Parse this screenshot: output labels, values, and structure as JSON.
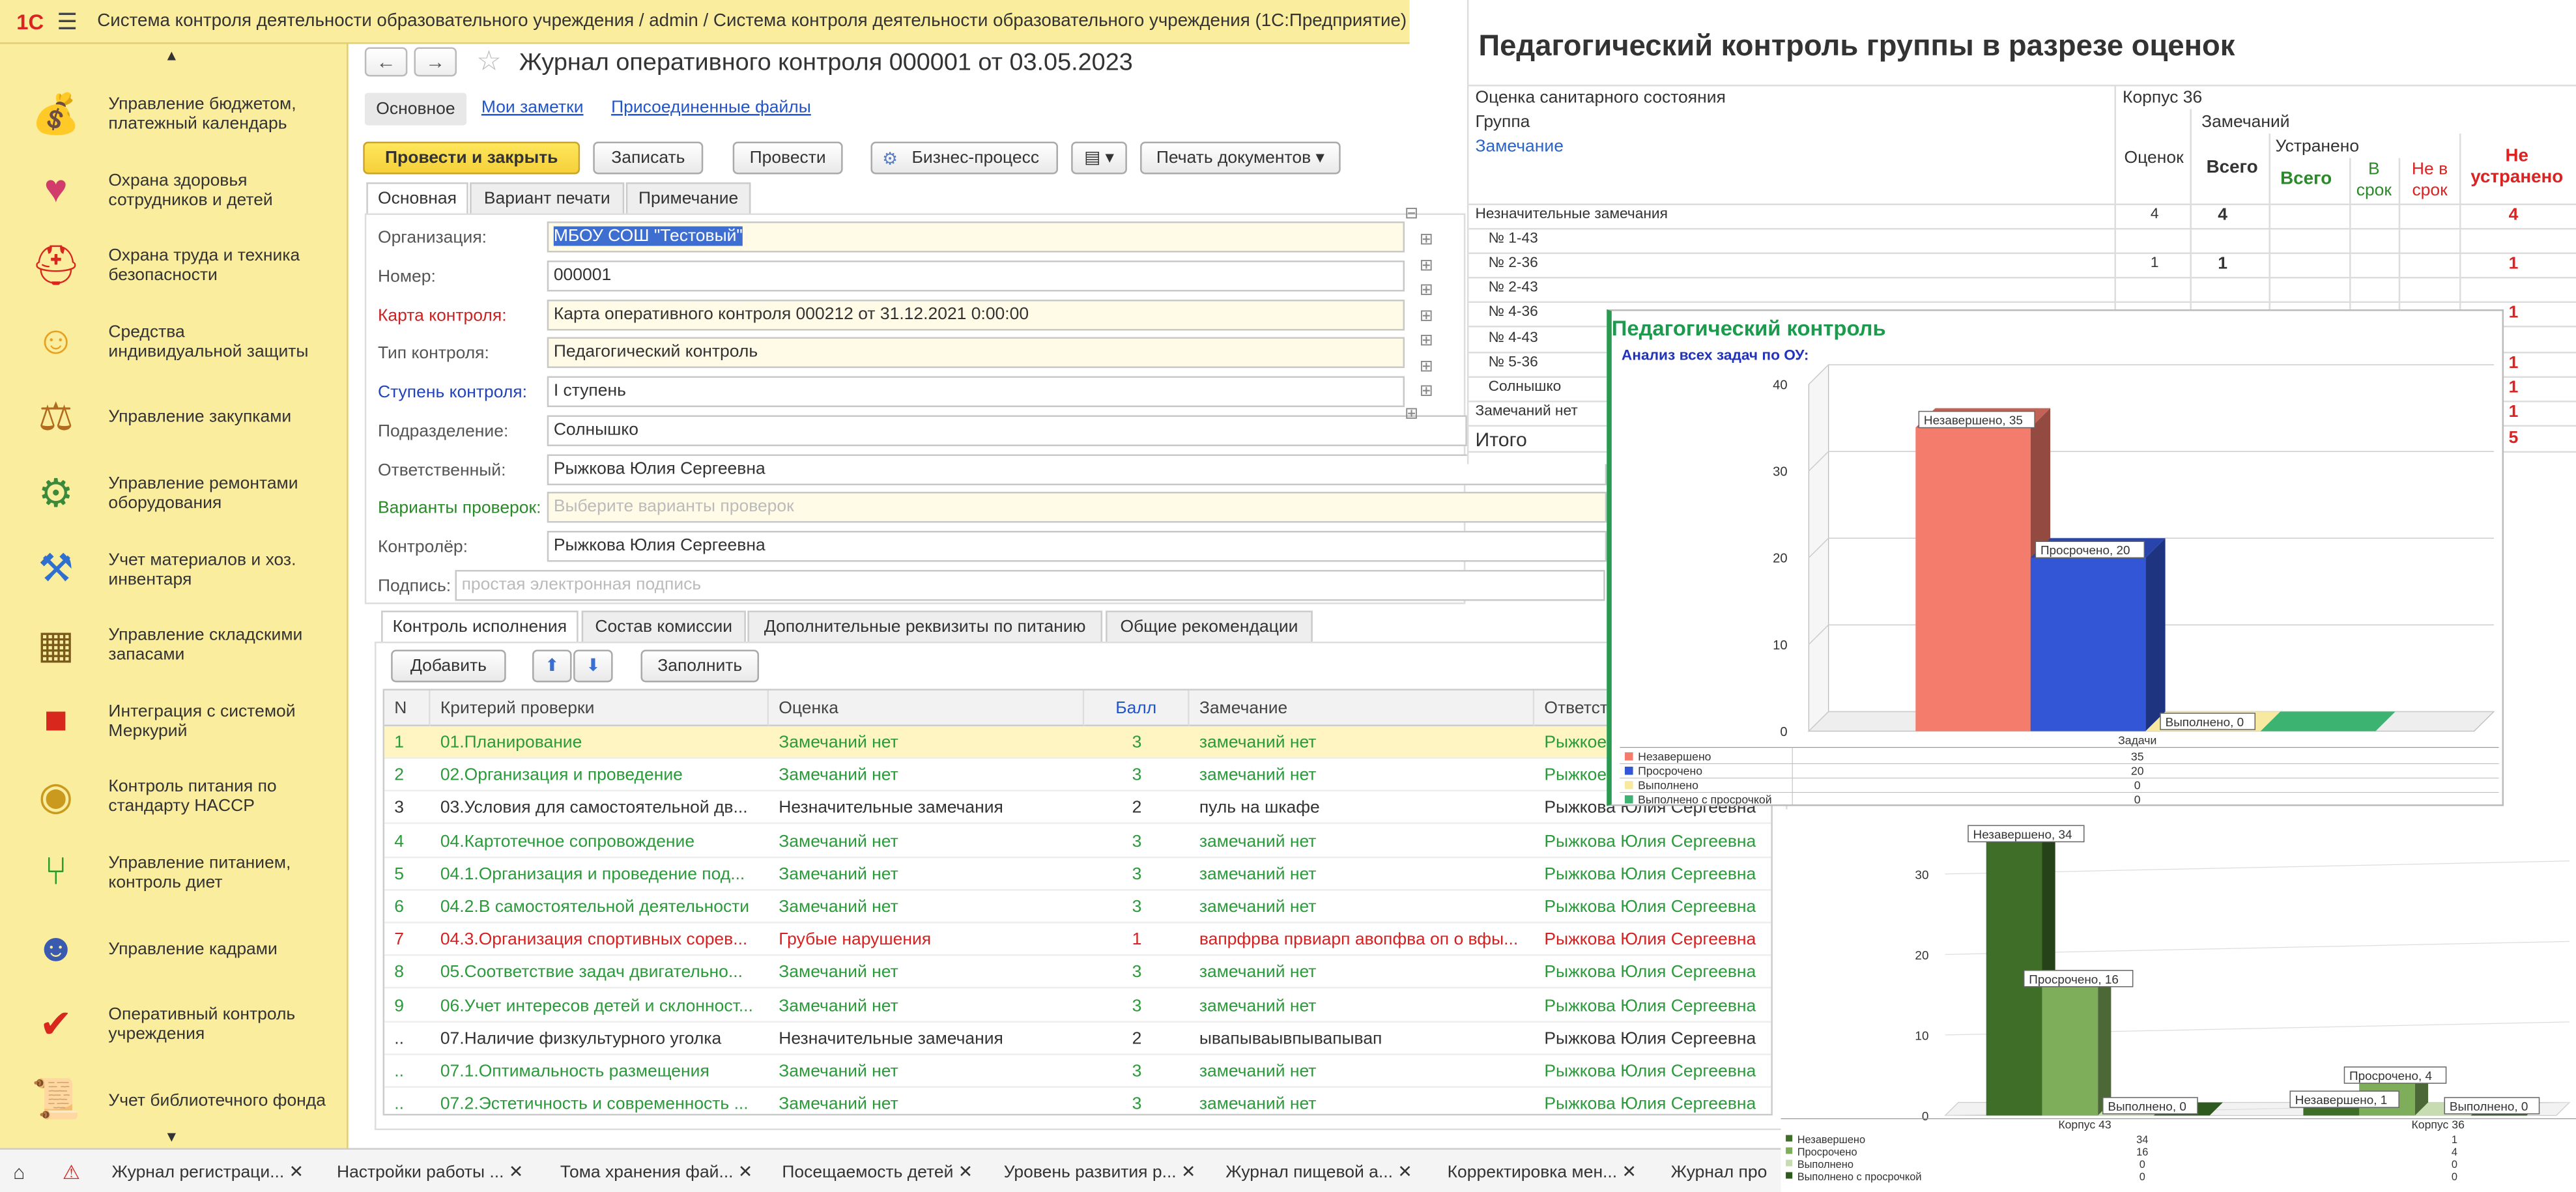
{
  "window": {
    "logo": "1С",
    "title": "Система контроля деятельности образовательного учреждения / admin / Система контроля деятельности образовательного учреждения  (1С:Предприятие)"
  },
  "sidebar": {
    "items": [
      {
        "label": "Управление бюджетом,\nплатежный календарь",
        "icon": "budget-icon"
      },
      {
        "label": "Охрана здоровья\nсотрудников и детей",
        "icon": "health-icon"
      },
      {
        "label": "Охрана труда и техника\nбезопасности",
        "icon": "helmet-icon"
      },
      {
        "label": "Средства\nиндивидуальной защиты",
        "icon": "ppe-icon"
      },
      {
        "label": "Управление закупками",
        "icon": "scales-icon"
      },
      {
        "label": "Управление ремонтами\nоборудования",
        "icon": "gears-icon"
      },
      {
        "label": "Учет материалов и хоз.\nинвентаря",
        "icon": "inventory-icon"
      },
      {
        "label": "Управление складскими\nзапасами",
        "icon": "forklift-icon"
      },
      {
        "label": "Интеграция с системой\nМеркурий",
        "icon": "cube-icon"
      },
      {
        "label": "Контроль питания по\nстандарту HACCP",
        "icon": "haccp-icon"
      },
      {
        "label": "Управление питанием,\nконтроль диет",
        "icon": "cutlery-icon"
      },
      {
        "label": "Управление кадрами",
        "icon": "person-icon"
      },
      {
        "label": "Оперативный контроль\nучреждения",
        "icon": "checkmark-icon"
      },
      {
        "label": "Учет библиотечного фонда",
        "icon": "scroll-icon"
      }
    ]
  },
  "document": {
    "title": "Журнал оперативного контроля 000001 от 03.05.2023",
    "top_tabs": [
      "Основное",
      "Мои заметки",
      "Присоединенные файлы"
    ],
    "toolbar": {
      "post_close": "Провести и закрыть",
      "save": "Записать",
      "post": "Провести",
      "bp": "Бизнес-процесс",
      "print": "Печать документов"
    },
    "form_tabs": [
      "Основная",
      "Вариант печати",
      "Примечание"
    ],
    "fields": {
      "org_label": "Организация:",
      "org_value": "МБОУ СОШ \"Тестовый\"",
      "num_label": "Номер:",
      "num_value": "000001",
      "card_label": "Карта контроля:",
      "card_value": "Карта оперативного контроля 000212 от 31.12.2021 0:00:00",
      "type_label": "Тип контроля:",
      "type_value": "Педагогический контроль",
      "step_label": "Ступень контроля:",
      "step_value": "I ступень",
      "dept_label": "Подразделение:",
      "dept_value": "Солнышко",
      "resp_label": "Ответственный:",
      "resp_value": "Рыжкова Юлия Сергеевна",
      "variants_label": "Варианты проверок:",
      "variants_placeholder": "Выберите варианты проверок",
      "ctrl_label": "Контролёр:",
      "ctrl_value": "Рыжкова Юлия Сергеевна",
      "sign_label": "Подпись:",
      "sign_placeholder": "простая электронная подпись"
    },
    "lower_tabs": [
      "Контроль исполнения",
      "Состав комиссии",
      "Дополнительные реквизиты по питанию",
      "Общие рекомендации"
    ],
    "lower_toolbar": {
      "add": "Добавить",
      "fill": "Заполнить"
    },
    "grid": {
      "headers": [
        "N",
        "Критерий проверки",
        "Оценка",
        "Балл",
        "Замечание",
        "Ответст"
      ],
      "rows": [
        {
          "n": "1",
          "criterion": "01.Планирование",
          "grade": "Замечаний нет",
          "score": "3",
          "remark": "замечаний нет",
          "resp": "Рыжкое",
          "style": "green",
          "selected": true
        },
        {
          "n": "2",
          "criterion": "02.Организация и проведение",
          "grade": "Замечаний нет",
          "score": "3",
          "remark": "замечаний нет",
          "resp": "Рыжкое",
          "style": "green"
        },
        {
          "n": "3",
          "criterion": "03.Условия для самостоятельной дв...",
          "grade": "Незначительные замечания",
          "score": "2",
          "remark": "пуль на шкафе",
          "resp": "Рыжкова Юлия Сергеевна",
          "style": "black"
        },
        {
          "n": "4",
          "criterion": "04.Картотечное сопровождение",
          "grade": "Замечаний нет",
          "score": "3",
          "remark": "замечаний нет",
          "resp": "Рыжкова Юлия Сергеевна",
          "style": "green"
        },
        {
          "n": "5",
          "criterion": "04.1.Организация и проведение под...",
          "grade": "Замечаний нет",
          "score": "3",
          "remark": "замечаний нет",
          "resp": "Рыжкова Юлия Сергеевна",
          "style": "green"
        },
        {
          "n": "6",
          "criterion": "04.2.В самостоятельной деятельности",
          "grade": "Замечаний нет",
          "score": "3",
          "remark": "замечаний нет",
          "resp": "Рыжкова Юлия Сергеевна",
          "style": "green"
        },
        {
          "n": "7",
          "criterion": "04.3.Организация спортивных сорев...",
          "grade": "Грубые нарушения",
          "score": "1",
          "remark": "вапрфрва првиарп авопфва оп о вфы...",
          "resp": "Рыжкова Юлия Сергеевна",
          "style": "red"
        },
        {
          "n": "8",
          "criterion": "05.Соответствие задач двигательно...",
          "grade": "Замечаний нет",
          "score": "3",
          "remark": "замечаний нет",
          "resp": "Рыжкова Юлия Сергеевна",
          "style": "green"
        },
        {
          "n": "9",
          "criterion": "06.Учет интересов детей и склонност...",
          "grade": "Замечаний нет",
          "score": "3",
          "remark": "замечаний нет",
          "resp": "Рыжкова Юлия Сергеевна",
          "style": "green"
        },
        {
          "n": "..",
          "criterion": "07.Наличие физкультурного  уголка",
          "grade": "Незначительные замечания",
          "score": "2",
          "remark": "ывапываывпывапывап",
          "resp": "Рыжкова Юлия Сергеевна",
          "style": "black"
        },
        {
          "n": "..",
          "criterion": "07.1.Оптимальность размещения",
          "grade": "Замечаний нет",
          "score": "3",
          "remark": "замечаний нет",
          "resp": "Рыжкова Юлия Сергеевна",
          "style": "green"
        },
        {
          "n": "..",
          "criterion": "07.2.Эстетичность и современность ...",
          "grade": "Замечаний нет",
          "score": "3",
          "remark": "замечаний нет",
          "resp": "Рыжкова Юлия Сергеевна",
          "style": "green"
        }
      ]
    }
  },
  "taskbar": {
    "items": [
      "Журнал регистраци...",
      "Настройки работы ...",
      "Тома хранения фай...",
      "Посещаемость детей",
      "Уровень развития р...",
      "Журнал пищевой а...",
      "Корректировка мен...",
      "Журнал про"
    ]
  },
  "report": {
    "title": "Педагогический контроль группы в разрезе оценок",
    "row_header1": "Оценка санитарного состояния",
    "row_header2": "Группа",
    "row_header3": "Замечание",
    "korpus": "Корпус 36",
    "col_remarks": "Замечаний",
    "col_fixed": "Устранено",
    "col_grades": "Оценок",
    "col_total": "Всего",
    "col_fixed_total": "Всего",
    "col_on_time": "В срок",
    "col_late": "Не в срок",
    "col_not_fixed": "Не устранено",
    "rows": [
      {
        "label": "Незначительные замечания",
        "grades": "4",
        "total": "4",
        "not_fixed": "4"
      },
      {
        "label": "№ 1-43",
        "grades": "",
        "total": "",
        "not_fixed": ""
      },
      {
        "label": "№ 2-36",
        "grades": "1",
        "total": "1",
        "not_fixed": "1"
      },
      {
        "label": "№ 2-43",
        "grades": "",
        "total": "",
        "not_fixed": ""
      },
      {
        "label": "№ 4-36",
        "grades": "",
        "total": "",
        "not_fixed": "1"
      },
      {
        "label": "№ 4-43",
        "grades": "",
        "total": "",
        "not_fixed": ""
      },
      {
        "label": "№ 5-36",
        "grades": "",
        "total": "",
        "not_fixed": "1"
      },
      {
        "label": "Солнышко",
        "grades": "",
        "total": "",
        "not_fixed": "1"
      },
      {
        "label": "Замечаний нет",
        "grades": "",
        "total": "",
        "not_fixed": "1"
      },
      {
        "label": "Итого",
        "grades": "",
        "total": "",
        "not_fixed": "5"
      }
    ]
  },
  "chart_data": [
    {
      "type": "bar",
      "title": "Педагогический контроль",
      "subtitle": "Анализ всех задач по ОУ:",
      "categories": [
        "Задачи"
      ],
      "ylim": [
        0,
        40
      ],
      "yticks": [
        0,
        10,
        20,
        30,
        40
      ],
      "series": [
        {
          "name": "Незавершено",
          "values": [
            35
          ],
          "color": "#f47c6c"
        },
        {
          "name": "Просрочено",
          "values": [
            20
          ],
          "color": "#3356d6"
        },
        {
          "name": "Выполнено",
          "values": [
            0
          ],
          "color": "#f7e9a0"
        },
        {
          "name": "Выполнено с просрочкой",
          "values": [
            0
          ],
          "color": "#3cb371"
        }
      ],
      "data_labels": [
        "Незавершено, 35",
        "Просрочено, 20",
        "Выполнено, 0"
      ]
    },
    {
      "type": "bar",
      "categories": [
        "Корпус 43",
        "Корпус 36"
      ],
      "ylim": [
        0,
        35
      ],
      "yticks": [
        0,
        10,
        20,
        30
      ],
      "series": [
        {
          "name": "Незавершено",
          "values": [
            34,
            1
          ],
          "color": "#3f6e28"
        },
        {
          "name": "Просрочено",
          "values": [
            16,
            4
          ],
          "color": "#7fae5a"
        },
        {
          "name": "Выполнено",
          "values": [
            0,
            0
          ],
          "color": "#c7dcb0"
        },
        {
          "name": "Выполнено с просрочкой",
          "values": [
            0,
            0
          ],
          "color": "#2f5a1e"
        }
      ],
      "data_labels": [
        "Незавершено, 34",
        "Просрочено, 16",
        "Выполнено, 0",
        "Незавершено, 1",
        "Просрочено, 4",
        "Выполнено, 0"
      ]
    }
  ]
}
